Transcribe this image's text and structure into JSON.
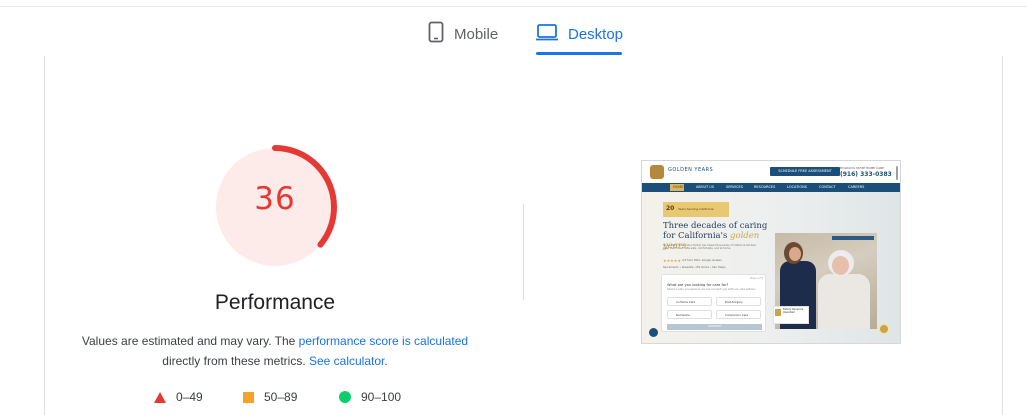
{
  "tabs": [
    {
      "label": "Mobile",
      "icon": "smartphone-icon",
      "active": false
    },
    {
      "label": "Desktop",
      "icon": "desktop-icon",
      "active": true
    }
  ],
  "colors": {
    "accent": "#1a73e8",
    "fail": "#e53935",
    "fail_bg": "#fdebea",
    "average": "#f4a328",
    "pass": "#0cce6b"
  },
  "gauge": {
    "score": "36",
    "fraction": 0.36
  },
  "performance": {
    "title": "Performance",
    "desc_part1": "Values are estimated and may vary. The ",
    "desc_link1": "performance score is calculated",
    "desc_part2": "directly from these metrics. ",
    "desc_link2": "See calculator",
    "desc_end": "."
  },
  "legend": [
    {
      "range": "0–49",
      "icon": "red-triangle-icon"
    },
    {
      "range": "50–89",
      "icon": "orange-square-icon"
    },
    {
      "range": "90–100",
      "icon": "green-circle-icon"
    }
  ],
  "screenshot": {
    "logo": "GOLDEN YEARS",
    "cta": "SCHEDULE FREE ASSESSMENT",
    "phone_label": "HOLIDAYS STATE HOME CARE",
    "phone": "(916) 333-0383",
    "nav": [
      "HOME",
      "ABOUT US",
      "SERVICES",
      "RESOURCES",
      "LOCATIONS",
      "CONTACT",
      "CAREERS"
    ],
    "award_number": "20",
    "award_text": "Years Serving California",
    "headline": "Three decades of caring for California's",
    "headline_accent": "golden years.",
    "body": "Since 1995, the Golden Family has helped thousands of California families keep their loved ones safe, comfortable, and at home.",
    "stars": "★★★★★",
    "stars_note": "4.8 from 300+ Google reviews",
    "tagline": "Sacramento • Roseville • Elk Grove • San Diego",
    "question": "What are you looking for care for?",
    "question_sub": "Select a plan you want so we can connect you with our care options",
    "step": "Step 1 of 4",
    "options": [
      "In-Home Care",
      "Post-Surgery",
      "Dementia",
      "Companion Care"
    ],
    "submit": "CONTINUE",
    "trust_text": "Family Owned & Operated"
  }
}
